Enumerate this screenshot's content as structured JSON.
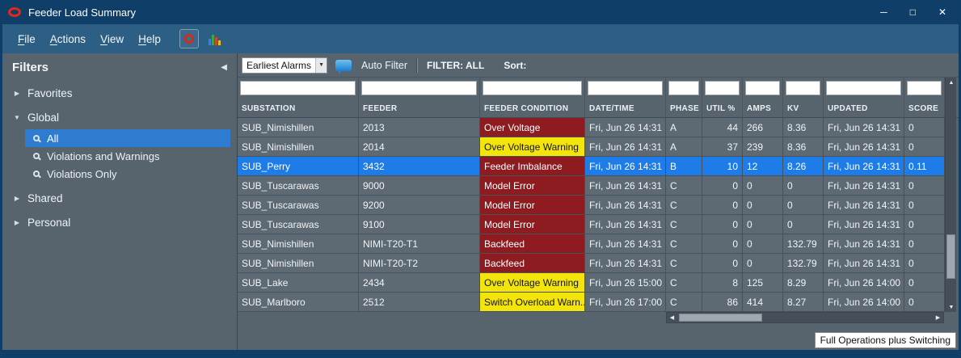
{
  "window": {
    "title": "Feeder Load Summary",
    "controls": {
      "minimize": "─",
      "maximize": "□",
      "close": "✕"
    }
  },
  "menu": {
    "items": [
      {
        "label": "File",
        "mnemonic": "F",
        "rest": "ile"
      },
      {
        "label": "Actions",
        "mnemonic": "A",
        "rest": "ctions"
      },
      {
        "label": "View",
        "mnemonic": "V",
        "rest": "iew"
      },
      {
        "label": "Help",
        "mnemonic": "H",
        "rest": "elp"
      }
    ]
  },
  "filters": {
    "title": "Filters",
    "collapse_icon": "◀",
    "groups": [
      {
        "label": "Favorites",
        "expanded": false
      },
      {
        "label": "Global",
        "expanded": true
      },
      {
        "label": "Shared",
        "expanded": false
      },
      {
        "label": "Personal",
        "expanded": false
      }
    ],
    "global_items": [
      {
        "label": "All",
        "selected": true
      },
      {
        "label": "Violations and Warnings",
        "selected": false
      },
      {
        "label": "Violations Only",
        "selected": false
      }
    ]
  },
  "toolbar": {
    "alarm_dropdown_value": "Earliest Alarms",
    "auto_filter_label": "Auto Filter",
    "filter_status": "FILTER: ALL",
    "sort_label": "Sort:"
  },
  "table": {
    "columns": [
      "SUBSTATION",
      "FEEDER",
      "FEEDER CONDITION",
      "DATE/TIME",
      "PHASE",
      "UTIL %",
      "AMPS",
      "KV",
      "UPDATED",
      "SCORE"
    ],
    "rows": [
      {
        "substation": "SUB_Nimishillen",
        "feeder": "2013",
        "condition": "Over Voltage",
        "severity": "critical",
        "datetime": "Fri, Jun 26 14:31",
        "phase": "A",
        "util": "44",
        "amps": "266",
        "kv": "8.36",
        "updated": "Fri, Jun 26 14:31",
        "score": "0",
        "selected": false
      },
      {
        "substation": "SUB_Nimishillen",
        "feeder": "2014",
        "condition": "Over Voltage Warning",
        "severity": "warning",
        "datetime": "Fri, Jun 26 14:31",
        "phase": "A",
        "util": "37",
        "amps": "239",
        "kv": "8.36",
        "updated": "Fri, Jun 26 14:31",
        "score": "0",
        "selected": false
      },
      {
        "substation": "SUB_Perry",
        "feeder": "3432",
        "condition": "Feeder Imbalance",
        "severity": "critical",
        "datetime": "Fri, Jun 26 14:31",
        "phase": "B",
        "util": "10",
        "amps": "12",
        "kv": "8.26",
        "updated": "Fri, Jun 26 14:31",
        "score": "0.11",
        "selected": true
      },
      {
        "substation": "SUB_Tuscarawas",
        "feeder": "9000",
        "condition": "Model Error",
        "severity": "critical",
        "datetime": "Fri, Jun 26 14:31",
        "phase": "C",
        "util": "0",
        "amps": "0",
        "kv": "0",
        "updated": "Fri, Jun 26 14:31",
        "score": "0",
        "selected": false
      },
      {
        "substation": "SUB_Tuscarawas",
        "feeder": "9200",
        "condition": "Model Error",
        "severity": "critical",
        "datetime": "Fri, Jun 26 14:31",
        "phase": "C",
        "util": "0",
        "amps": "0",
        "kv": "0",
        "updated": "Fri, Jun 26 14:31",
        "score": "0",
        "selected": false
      },
      {
        "substation": "SUB_Tuscarawas",
        "feeder": "9100",
        "condition": "Model Error",
        "severity": "critical",
        "datetime": "Fri, Jun 26 14:31",
        "phase": "C",
        "util": "0",
        "amps": "0",
        "kv": "0",
        "updated": "Fri, Jun 26 14:31",
        "score": "0",
        "selected": false
      },
      {
        "substation": "SUB_Nimishillen",
        "feeder": "NIMI-T20-T1",
        "condition": "Backfeed",
        "severity": "critical",
        "datetime": "Fri, Jun 26 14:31",
        "phase": "C",
        "util": "0",
        "amps": "0",
        "kv": "132.79",
        "updated": "Fri, Jun 26 14:31",
        "score": "0",
        "selected": false
      },
      {
        "substation": "SUB_Nimishillen",
        "feeder": "NIMI-T20-T2",
        "condition": "Backfeed",
        "severity": "critical",
        "datetime": "Fri, Jun 26 14:31",
        "phase": "C",
        "util": "0",
        "amps": "0",
        "kv": "132.79",
        "updated": "Fri, Jun 26 14:31",
        "score": "0",
        "selected": false
      },
      {
        "substation": "SUB_Lake",
        "feeder": "2434",
        "condition": "Over Voltage Warning",
        "severity": "warning",
        "datetime": "Fri, Jun 26 15:00",
        "phase": "C",
        "util": "8",
        "amps": "125",
        "kv": "8.29",
        "updated": "Fri, Jun 26 14:00",
        "score": "0",
        "selected": false
      },
      {
        "substation": "SUB_Marlboro",
        "feeder": "2512",
        "condition": "Switch Overload Warn...",
        "severity": "warning",
        "datetime": "Fri, Jun 26 17:00",
        "phase": "C",
        "util": "86",
        "amps": "414",
        "kv": "8.27",
        "updated": "Fri, Jun 26 14:00",
        "score": "0",
        "selected": false
      }
    ]
  },
  "status": {
    "mode_tooltip": "Full Operations plus Switching"
  },
  "colors": {
    "titlebar_bg": "#0f3f68",
    "menubar_bg": "#2d5f85",
    "panel_bg": "#57646e",
    "row_bg": "#5d6a73",
    "grid_line": "#46515a",
    "critical_bg": "#8e1b20",
    "critical_text": "#ffffff",
    "warning_bg": "#f3e50c",
    "warning_text": "#141414",
    "selected_row_bg": "#1e7ce9",
    "selected_filter_bg": "#2e7cd0"
  }
}
